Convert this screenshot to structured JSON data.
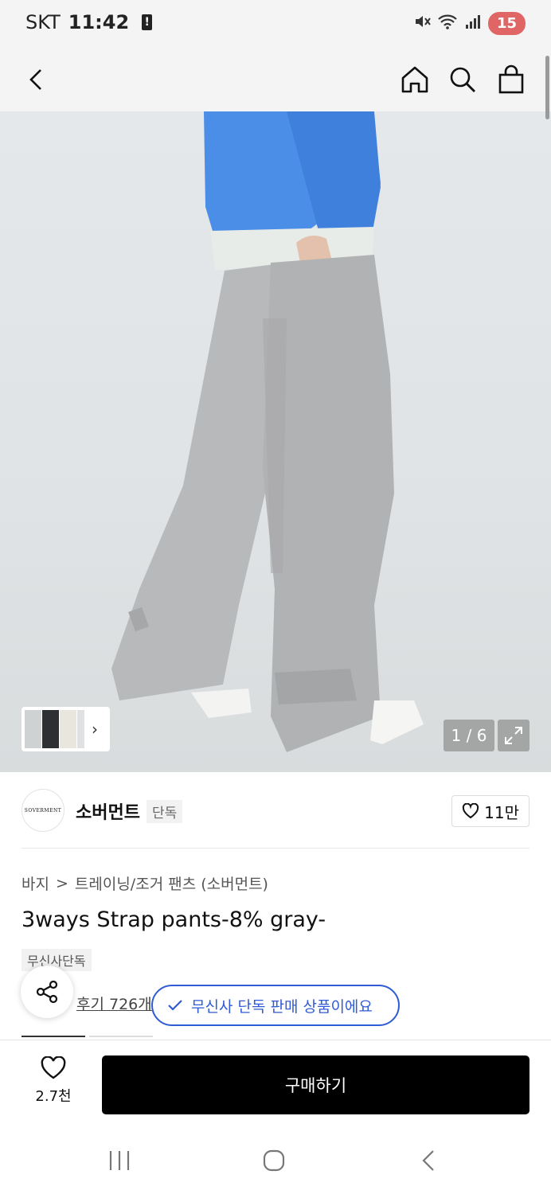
{
  "status_bar": {
    "carrier": "SKT",
    "time": "11:42",
    "battery": "15"
  },
  "gallery": {
    "counter": "1 / 6"
  },
  "brand": {
    "logo_text": "SOVERMENT",
    "name": "소버먼트",
    "tag": "단독",
    "likes": "11만"
  },
  "breadcrumb": {
    "category": "바지",
    "separator": ">",
    "subcategory": "트레이닝/조거 팬츠 (소버먼트)"
  },
  "product": {
    "title": "3ways Strap pants-8% gray-",
    "exclusive_tag": "무신사단독",
    "reviews": "후기 726개"
  },
  "toast": {
    "message": "무신사 단독 판매 상품이에요"
  },
  "bottom_bar": {
    "wish_count": "2.7천",
    "buy_label": "구매하기"
  },
  "colors": {
    "accent": "#2f5bd6",
    "buy_button": "#000000",
    "sweatshirt": "#4b8ee8",
    "pants": "#b5b6b8"
  }
}
